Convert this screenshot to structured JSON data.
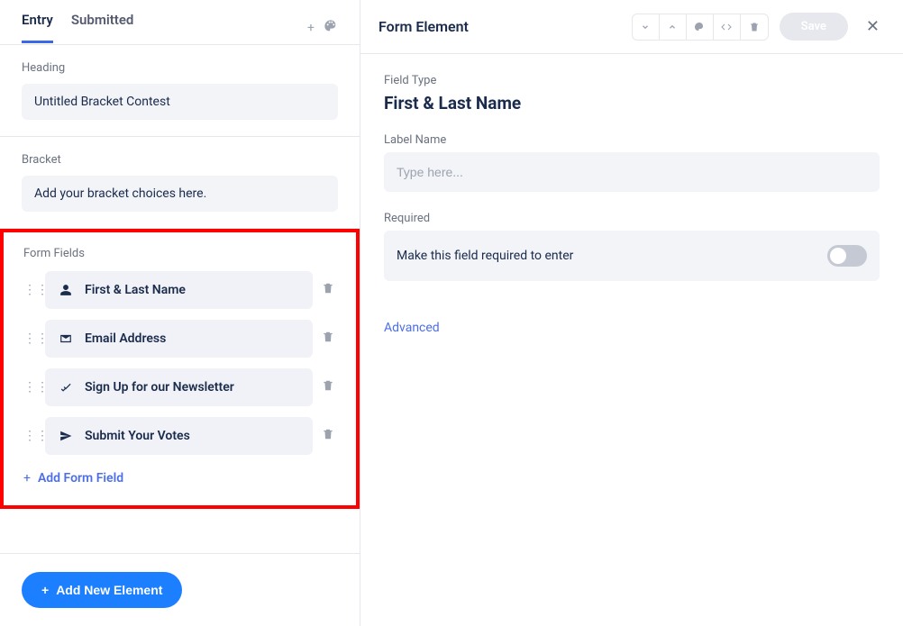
{
  "tabs": {
    "entry": "Entry",
    "submitted": "Submitted"
  },
  "heading": {
    "label": "Heading",
    "value": "Untitled Bracket Contest"
  },
  "bracket": {
    "label": "Bracket",
    "value": "Add your bracket choices here."
  },
  "formFields": {
    "label": "Form Fields",
    "items": [
      {
        "label": "First & Last Name"
      },
      {
        "label": "Email Address"
      },
      {
        "label": "Sign Up for our Newsletter"
      },
      {
        "label": "Submit Your Votes"
      }
    ],
    "addLabel": "Add Form Field"
  },
  "addElementLabel": "Add New Element",
  "rightPanel": {
    "title": "Form Element",
    "saveLabel": "Save",
    "fieldTypeLabel": "Field Type",
    "fieldTypeValue": "First & Last Name",
    "labelNameLabel": "Label Name",
    "labelNamePlaceholder": "Type here...",
    "requiredLabel": "Required",
    "requiredDesc": "Make this field required to enter",
    "advancedLabel": "Advanced"
  }
}
